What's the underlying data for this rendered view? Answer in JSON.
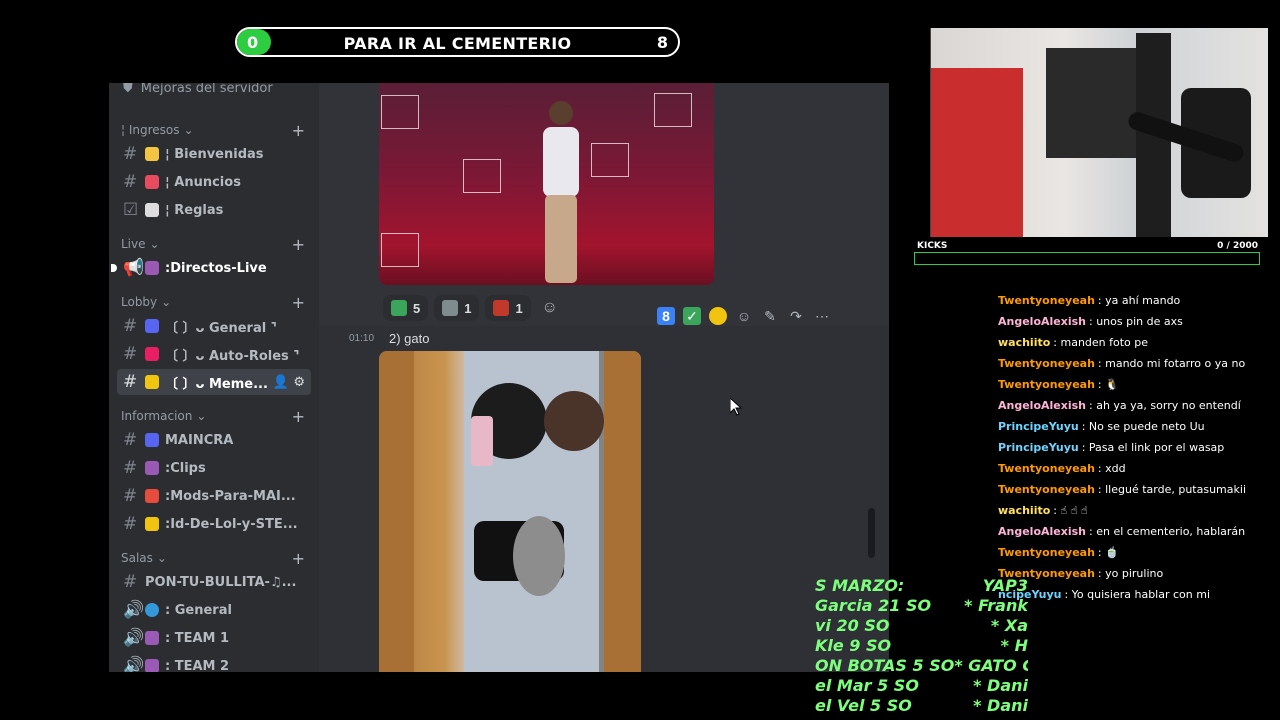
{
  "goal": {
    "start": "0",
    "title": "PARA IR AL CEMENTERIO",
    "end": "8",
    "progress_fraction": 0
  },
  "sidebar": {
    "top_item": "Mejoras del servidor",
    "categories": [
      {
        "label": "¦ Ingresos"
      },
      {
        "label": "Live"
      },
      {
        "label": "Lobby"
      },
      {
        "label": "Informacion"
      },
      {
        "label": "Salas"
      }
    ],
    "channels": [
      {
        "label": "¦ Bienvenidas",
        "emoji_color": "#f4c542"
      },
      {
        "label": "¦ Anuncios",
        "emoji_color": "#e84a5f"
      },
      {
        "label": "¦ Reglas",
        "emoji_color": "#dddddd"
      },
      {
        "label": ":Directos-Live",
        "emoji_color": "#9b59b6"
      },
      {
        "label": "〔 〕ᴗ General ⌝",
        "emoji_color": "#5865f2"
      },
      {
        "label": "〔 〕ᴗ Auto-Roles ⌝",
        "emoji_color": "#e91e63"
      },
      {
        "label": "〔 〕ᴗ Meme...",
        "emoji_color": "#f1c40f"
      },
      {
        "label": "MAINCRA",
        "emoji_color": "#5865f2"
      },
      {
        "label": ":Clips",
        "emoji_color": "#9b59b6"
      },
      {
        "label": ":Mods-Para-MAI...",
        "emoji_color": "#e74c3c"
      },
      {
        "label": ":Id-De-Lol-y-STE...",
        "emoji_color": "#f1c40f"
      },
      {
        "label": "PON-TU-BULLITA-♫...",
        "emoji_color": ""
      },
      {
        "label": ": General",
        "emoji_color": "#3498db"
      },
      {
        "label": ": TEAM 1",
        "emoji_color": "#9b59b6"
      },
      {
        "label": ": TEAM 2",
        "emoji_color": "#9b59b6"
      }
    ]
  },
  "chat_area": {
    "reactions": [
      {
        "count": "5",
        "icon": "check-emoji",
        "color": "#3ba55c"
      },
      {
        "count": "1",
        "icon": "custom-emoji",
        "color": "#7f8c8d"
      },
      {
        "count": "1",
        "icon": "burger-emoji",
        "color": "#c0392b"
      }
    ],
    "timestamp": "01:10",
    "message": "2) gato",
    "toolbar_icons": [
      "number-8-emoji",
      "check-emoji",
      "laughing-emoji",
      "add-reaction-icon",
      "edit-icon",
      "reply-icon",
      "more-icon"
    ]
  },
  "kicks": {
    "label": "KICKS",
    "count": "0 / 2000",
    "progress_fraction": 0
  },
  "stream_chat": [
    {
      "user": "Twentyoneyeah",
      "color": "#ff9900",
      "text": ": ya ahí mando",
      "badge": false
    },
    {
      "user": "AngeloAlexish",
      "color": "#ffb3d9",
      "text": ": unos pin de axs",
      "badge": false
    },
    {
      "user": "wachiito",
      "color": "#ffe066",
      "text": ": manden foto pe",
      "badge": false
    },
    {
      "user": "Twentyoneyeah",
      "color": "#ff9900",
      "text": ": mando mi fotarro o ya no",
      "badge": false
    },
    {
      "user": "Twentyoneyeah",
      "color": "#ff9900",
      "text": ": 🐧",
      "badge": false
    },
    {
      "user": "AngeloAlexish",
      "color": "#ffb3d9",
      "text": ": ah ya ya, sorry no entendí",
      "badge": false
    },
    {
      "user": "PrincipeYuyu",
      "color": "#6fd3ff",
      "text": ": No se puede neto Uu",
      "badge": true
    },
    {
      "user": "PrincipeYuyu",
      "color": "#6fd3ff",
      "text": ": Pasa el link por el wasap",
      "badge": true
    },
    {
      "user": "Twentyoneyeah",
      "color": "#ff9900",
      "text": ": xdd",
      "badge": false
    },
    {
      "user": "Twentyoneyeah",
      "color": "#ff9900",
      "text": ": llegué tarde, putasumakii",
      "badge": false
    },
    {
      "user": "wachiito",
      "color": "#ffe066",
      "text": ": ☝ ☝ ☝",
      "badge": false
    },
    {
      "user": "AngeloAlexish",
      "color": "#ffb3d9",
      "text": ": en el cementerio, hablarán",
      "badge": false
    },
    {
      "user": "Twentyoneyeah",
      "color": "#ff9900",
      "text": ": 🍵",
      "badge": false
    },
    {
      "user": "Twentyoneyeah",
      "color": "#ff9900",
      "text": ": yo pirulino",
      "badge": false
    },
    {
      "user": "ncipeYuyu",
      "color": "#6fd3ff",
      "text": ": Yo quisiera hablar con mi",
      "badge": false
    }
  ],
  "ticker": [
    {
      "left": "S MARZO:",
      "right": "YAP3"
    },
    {
      "left": "Garcia 21 SO",
      "right": "* Frank"
    },
    {
      "left": "vi 20 SO",
      "right": "* Xa"
    },
    {
      "left": "Kle 9 SO",
      "right": "* H"
    },
    {
      "left": "ON BOTAS 5 SO* GATO CO",
      "right": ""
    },
    {
      "left": "el Mar 5 SO",
      "right": "* Dani"
    },
    {
      "left": "el Vel 5 SO",
      "right": "* Dani"
    }
  ]
}
